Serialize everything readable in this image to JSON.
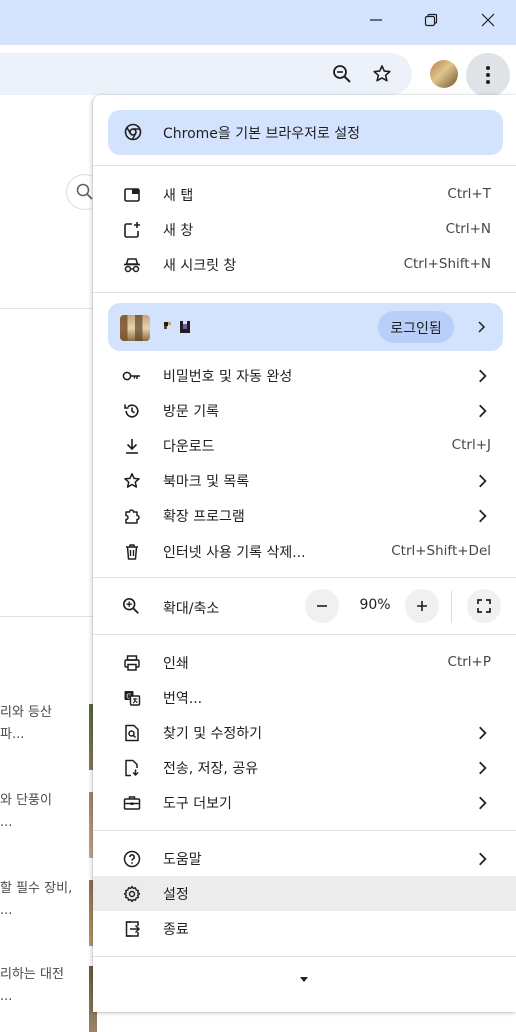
{
  "background_page": {
    "snippets": [
      {
        "line1": "리와 등산",
        "line2": "파..."
      },
      {
        "line1": "와 단풍이",
        "line2": "..."
      },
      {
        "line1": "할 필수 장비,",
        "line2": "..."
      },
      {
        "line1": "리하는 대전",
        "line2": "..."
      }
    ]
  },
  "menu": {
    "default_browser": "Chrome을 기본 브라우저로 설정",
    "new_tab": {
      "label": "새 탭",
      "shortcut": "Ctrl+T"
    },
    "new_window": {
      "label": "새 창",
      "shortcut": "Ctrl+N"
    },
    "incognito": {
      "label": "새 시크릿 창",
      "shortcut": "Ctrl+Shift+N"
    },
    "profile": {
      "login_label": "로그인됨"
    },
    "passwords": {
      "label": "비밀번호 및 자동 완성"
    },
    "history": {
      "label": "방문 기록"
    },
    "downloads": {
      "label": "다운로드",
      "shortcut": "Ctrl+J"
    },
    "bookmarks": {
      "label": "북마크 및 목록"
    },
    "extensions": {
      "label": "확장 프로그램"
    },
    "clear_data": {
      "label": "인터넷 사용 기록 삭제...",
      "shortcut": "Ctrl+Shift+Del"
    },
    "zoom": {
      "label": "확대/축소",
      "value": "90%"
    },
    "print": {
      "label": "인쇄",
      "shortcut": "Ctrl+P"
    },
    "translate": {
      "label": "번역..."
    },
    "find_edit": {
      "label": "찾기 및 수정하기"
    },
    "cast_save_share": {
      "label": "전송, 저장, 공유"
    },
    "more_tools": {
      "label": "도구 더보기"
    },
    "help": {
      "label": "도움말"
    },
    "settings": {
      "label": "설정"
    },
    "exit": {
      "label": "종료"
    }
  },
  "colors": {
    "titlebar": "#d3e3fd",
    "banner": "#d3e3fd",
    "login_pill": "#b9cffa",
    "hover": "#ececec"
  },
  "icons": [
    "minimize-icon",
    "restore-icon",
    "close-icon",
    "zoom-icon",
    "star-icon",
    "kebab-menu-icon",
    "chrome-logo-icon",
    "new-tab-icon",
    "new-window-icon",
    "incognito-icon",
    "key-icon",
    "history-icon",
    "download-icon",
    "star-icon",
    "puzzle-icon",
    "trash-icon",
    "zoom-icon",
    "minus-icon",
    "plus-icon",
    "fullscreen-icon",
    "print-icon",
    "translate-icon",
    "find-icon",
    "save-share-icon",
    "toolbox-icon",
    "help-icon",
    "gear-icon",
    "exit-icon",
    "chevron-right-icon",
    "chevron-down-icon"
  ]
}
